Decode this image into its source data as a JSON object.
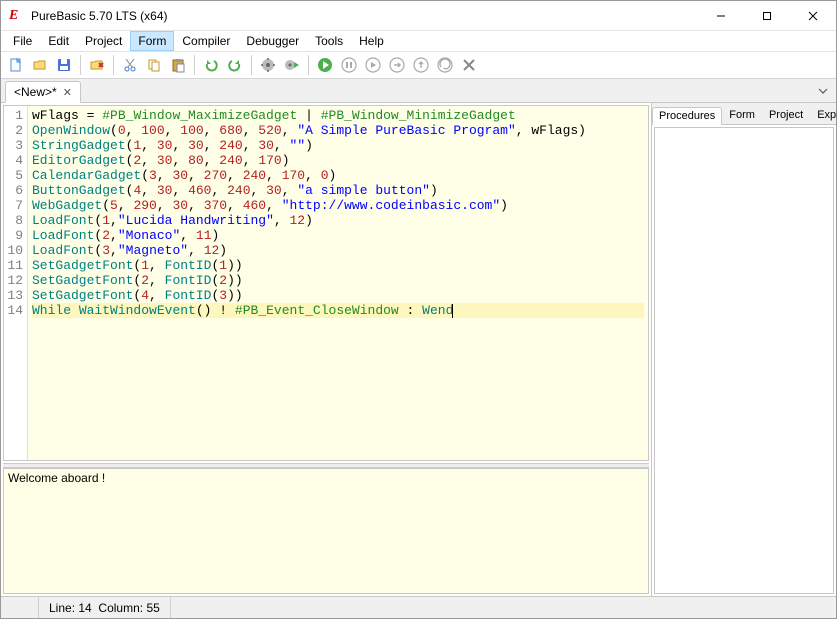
{
  "window": {
    "title": "PureBasic 5.70 LTS (x64)"
  },
  "menu": {
    "items": [
      "File",
      "Edit",
      "Project",
      "Form",
      "Compiler",
      "Debugger",
      "Tools",
      "Help"
    ],
    "active_index": 3
  },
  "toolbar": {
    "icons": [
      "new-file-icon",
      "open-file-icon",
      "save-file-icon",
      "|",
      "close-icon",
      "|",
      "cut-icon",
      "copy-icon",
      "paste-icon",
      "|",
      "undo-icon",
      "redo-icon",
      "|",
      "compile-icon",
      "compile-run-icon",
      "|",
      "run-icon",
      "pause-icon",
      "step-over-icon",
      "step-into-icon",
      "step-out-icon",
      "continue-icon",
      "stop-icon"
    ]
  },
  "tabs": {
    "files": [
      {
        "label": "<New>*"
      }
    ]
  },
  "right_panel": {
    "tabs": [
      "Procedures",
      "Form",
      "Project",
      "Explorer"
    ],
    "active_index": 0
  },
  "editor": {
    "active_line": 14,
    "lines": [
      {
        "n": 1,
        "tokens": [
          [
            "",
            "wFlags "
          ],
          [
            "op",
            "="
          ],
          [
            "",
            " "
          ],
          [
            "const",
            "#PB_Window_MaximizeGadget"
          ],
          [
            "",
            " "
          ],
          [
            "op",
            "|"
          ],
          [
            "",
            " "
          ],
          [
            "const",
            "#PB_Window_MinimizeGadget"
          ]
        ]
      },
      {
        "n": 2,
        "tokens": [
          [
            "func",
            "OpenWindow"
          ],
          [
            "punct",
            "("
          ],
          [
            "num",
            "0"
          ],
          [
            "punct",
            ", "
          ],
          [
            "num",
            "100"
          ],
          [
            "punct",
            ", "
          ],
          [
            "num",
            "100"
          ],
          [
            "punct",
            ", "
          ],
          [
            "num",
            "680"
          ],
          [
            "punct",
            ", "
          ],
          [
            "num",
            "520"
          ],
          [
            "punct",
            ", "
          ],
          [
            "str",
            "\"A Simple PureBasic Program\""
          ],
          [
            "punct",
            ", "
          ],
          [
            "",
            "wFlags"
          ],
          [
            "punct",
            ")"
          ]
        ]
      },
      {
        "n": 3,
        "tokens": [
          [
            "func",
            "StringGadget"
          ],
          [
            "punct",
            "("
          ],
          [
            "num",
            "1"
          ],
          [
            "punct",
            ", "
          ],
          [
            "num",
            "30"
          ],
          [
            "punct",
            ", "
          ],
          [
            "num",
            "30"
          ],
          [
            "punct",
            ", "
          ],
          [
            "num",
            "240"
          ],
          [
            "punct",
            ", "
          ],
          [
            "num",
            "30"
          ],
          [
            "punct",
            ", "
          ],
          [
            "str",
            "\"\""
          ],
          [
            "punct",
            ")"
          ]
        ]
      },
      {
        "n": 4,
        "tokens": [
          [
            "func",
            "EditorGadget"
          ],
          [
            "punct",
            "("
          ],
          [
            "num",
            "2"
          ],
          [
            "punct",
            ", "
          ],
          [
            "num",
            "30"
          ],
          [
            "punct",
            ", "
          ],
          [
            "num",
            "80"
          ],
          [
            "punct",
            ", "
          ],
          [
            "num",
            "240"
          ],
          [
            "punct",
            ", "
          ],
          [
            "num",
            "170"
          ],
          [
            "punct",
            ")"
          ]
        ]
      },
      {
        "n": 5,
        "tokens": [
          [
            "func",
            "CalendarGadget"
          ],
          [
            "punct",
            "("
          ],
          [
            "num",
            "3"
          ],
          [
            "punct",
            ", "
          ],
          [
            "num",
            "30"
          ],
          [
            "punct",
            ", "
          ],
          [
            "num",
            "270"
          ],
          [
            "punct",
            ", "
          ],
          [
            "num",
            "240"
          ],
          [
            "punct",
            ", "
          ],
          [
            "num",
            "170"
          ],
          [
            "punct",
            ", "
          ],
          [
            "num",
            "0"
          ],
          [
            "punct",
            ")"
          ]
        ]
      },
      {
        "n": 6,
        "tokens": [
          [
            "func",
            "ButtonGadget"
          ],
          [
            "punct",
            "("
          ],
          [
            "num",
            "4"
          ],
          [
            "punct",
            ", "
          ],
          [
            "num",
            "30"
          ],
          [
            "punct",
            ", "
          ],
          [
            "num",
            "460"
          ],
          [
            "punct",
            ", "
          ],
          [
            "num",
            "240"
          ],
          [
            "punct",
            ", "
          ],
          [
            "num",
            "30"
          ],
          [
            "punct",
            ", "
          ],
          [
            "str",
            "\"a simple button\""
          ],
          [
            "punct",
            ")"
          ]
        ]
      },
      {
        "n": 7,
        "tokens": [
          [
            "func",
            "WebGadget"
          ],
          [
            "punct",
            "("
          ],
          [
            "num",
            "5"
          ],
          [
            "punct",
            ", "
          ],
          [
            "num",
            "290"
          ],
          [
            "punct",
            ", "
          ],
          [
            "num",
            "30"
          ],
          [
            "punct",
            ", "
          ],
          [
            "num",
            "370"
          ],
          [
            "punct",
            ", "
          ],
          [
            "num",
            "460"
          ],
          [
            "punct",
            ", "
          ],
          [
            "str",
            "\"http://www.codeinbasic.com\""
          ],
          [
            "punct",
            ")"
          ]
        ]
      },
      {
        "n": 8,
        "tokens": [
          [
            "func",
            "LoadFont"
          ],
          [
            "punct",
            "("
          ],
          [
            "num",
            "1"
          ],
          [
            "punct",
            ","
          ],
          [
            "str",
            "\"Lucida Handwriting\""
          ],
          [
            "punct",
            ", "
          ],
          [
            "num",
            "12"
          ],
          [
            "punct",
            ")"
          ]
        ]
      },
      {
        "n": 9,
        "tokens": [
          [
            "func",
            "LoadFont"
          ],
          [
            "punct",
            "("
          ],
          [
            "num",
            "2"
          ],
          [
            "punct",
            ","
          ],
          [
            "str",
            "\"Monaco\""
          ],
          [
            "punct",
            ", "
          ],
          [
            "num",
            "11"
          ],
          [
            "punct",
            ")"
          ]
        ]
      },
      {
        "n": 10,
        "tokens": [
          [
            "func",
            "LoadFont"
          ],
          [
            "punct",
            "("
          ],
          [
            "num",
            "3"
          ],
          [
            "punct",
            ","
          ],
          [
            "str",
            "\"Magneto\""
          ],
          [
            "punct",
            ", "
          ],
          [
            "num",
            "12"
          ],
          [
            "punct",
            ")"
          ]
        ]
      },
      {
        "n": 11,
        "tokens": [
          [
            "func",
            "SetGadgetFont"
          ],
          [
            "punct",
            "("
          ],
          [
            "num",
            "1"
          ],
          [
            "punct",
            ", "
          ],
          [
            "func",
            "FontID"
          ],
          [
            "punct",
            "("
          ],
          [
            "num",
            "1"
          ],
          [
            "punct",
            "))"
          ]
        ]
      },
      {
        "n": 12,
        "tokens": [
          [
            "func",
            "SetGadgetFont"
          ],
          [
            "punct",
            "("
          ],
          [
            "num",
            "2"
          ],
          [
            "punct",
            ", "
          ],
          [
            "func",
            "FontID"
          ],
          [
            "punct",
            "("
          ],
          [
            "num",
            "2"
          ],
          [
            "punct",
            "))"
          ]
        ]
      },
      {
        "n": 13,
        "tokens": [
          [
            "func",
            "SetGadgetFont"
          ],
          [
            "punct",
            "("
          ],
          [
            "num",
            "4"
          ],
          [
            "punct",
            ", "
          ],
          [
            "func",
            "FontID"
          ],
          [
            "punct",
            "("
          ],
          [
            "num",
            "3"
          ],
          [
            "punct",
            "))"
          ]
        ]
      },
      {
        "n": 14,
        "tokens": [
          [
            "kw",
            "While"
          ],
          [
            "",
            " "
          ],
          [
            "func",
            "WaitWindowEvent"
          ],
          [
            "punct",
            "()"
          ],
          [
            "",
            " "
          ],
          [
            "op",
            "!"
          ],
          [
            "",
            " "
          ],
          [
            "const",
            "#PB_Event_CloseWindow"
          ],
          [
            "",
            " "
          ],
          [
            "punct",
            ":"
          ],
          [
            "",
            " "
          ],
          [
            "kw",
            "Wend"
          ]
        ]
      }
    ]
  },
  "console": {
    "text": "Welcome aboard !"
  },
  "status": {
    "line_label": "Line:",
    "line_value": "14",
    "col_label": "Column:",
    "col_value": "55"
  }
}
